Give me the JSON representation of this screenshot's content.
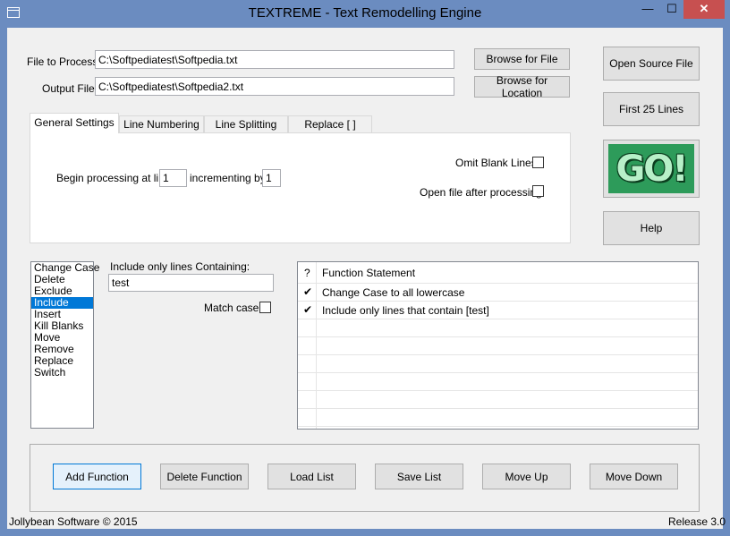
{
  "window": {
    "title": "TEXTREME - Text Remodelling Engine",
    "minimize": "—",
    "maximize": "☐",
    "close": "✕"
  },
  "files": {
    "file_label": "File to Process",
    "file_value": "C:\\Softpediatest\\Softpedia.txt",
    "output_label": "Output File",
    "output_value": "C:\\Softpediatest\\Softpedia2.txt",
    "browse_file": "Browse for File",
    "browse_location": "Browse for Location"
  },
  "side_buttons": {
    "open_source": "Open Source File",
    "first_lines": "First 25 Lines",
    "go": "GO!",
    "help": "Help"
  },
  "tabs": [
    {
      "label": "General Settings"
    },
    {
      "label": "Line Numbering"
    },
    {
      "label": "Line Splitting"
    },
    {
      "label": "Replace [ ]"
    }
  ],
  "general": {
    "begin_label": "Begin processing at line",
    "begin_value": "1",
    "increment_label": "incrementing by",
    "increment_value": "1",
    "omit_blank": "Omit Blank Lines",
    "open_after": "Open file after processing"
  },
  "functions": {
    "items": [
      "Change Case",
      "Delete",
      "Exclude",
      "Include",
      "Insert",
      "Kill Blanks",
      "Move",
      "Remove",
      "Replace",
      "Switch"
    ],
    "selected": "Include"
  },
  "include": {
    "label": "Include only lines Containing:",
    "value": "test",
    "match_case": "Match case"
  },
  "grid": {
    "col_check": "?",
    "col_statement": "Function Statement",
    "rows": [
      {
        "checked": "✔",
        "text": "Change Case to all lowercase"
      },
      {
        "checked": "✔",
        "text": "Include only lines that contain [test]"
      }
    ]
  },
  "bottom_buttons": {
    "add": "Add Function",
    "delete": "Delete Function",
    "load": "Load List",
    "save": "Save List",
    "up": "Move Up",
    "down": "Move Down"
  },
  "footer": {
    "company": "Jollybean Software © 2015",
    "release": "Release 3.0"
  },
  "colors": {
    "titlebar": "#6b8cc0",
    "close_button": "#c75050",
    "selection": "#0078d7",
    "go_green": "#2d9b5a"
  }
}
